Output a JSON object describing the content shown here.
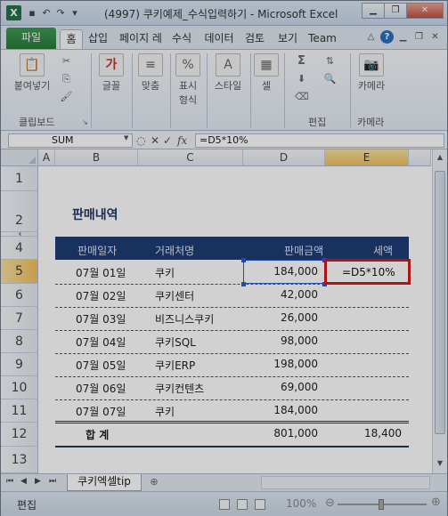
{
  "window": {
    "title": "(4997) 쿠키예제_수식입력하기 - Microsoft Excel",
    "app_icon": "X"
  },
  "ribbon_tabs": [
    "파일",
    "홈",
    "삽입",
    "페이지 레",
    "수식",
    "데이터",
    "검토",
    "보기",
    "Team"
  ],
  "ribbon": {
    "groups": {
      "clipboard": {
        "paste": "붙여넣기",
        "label": "클립보드"
      },
      "font": {
        "label": "글꼴"
      },
      "alignment": {
        "label": "맞춤"
      },
      "number": {
        "label1": "표시",
        "label2": "형식",
        "percent": "%"
      },
      "styles": {
        "label": "스타일"
      },
      "cells": {
        "label": "셀"
      },
      "editing": {
        "label": "편집",
        "sigma": "Σ"
      },
      "camera": {
        "button": "카메라",
        "label": "카메라"
      }
    }
  },
  "formula_bar": {
    "name_box": "SUM",
    "cancel": "✕",
    "enter": "✓",
    "fx": "fx",
    "formula": "=D5*10%"
  },
  "columns": [
    "A",
    "B",
    "C",
    "D",
    "E"
  ],
  "rows": [
    "1",
    "2",
    "3",
    "4",
    "5",
    "6",
    "7",
    "8",
    "9",
    "10",
    "11",
    "12",
    "13"
  ],
  "sheet": {
    "title": "판매내역",
    "headers": [
      "판매일자",
      "거래처명",
      "판매금액",
      "세액"
    ],
    "records": [
      {
        "date": "07월 01일",
        "client": "쿠키",
        "amount": "184,000",
        "tax": "=D5*10%"
      },
      {
        "date": "07월 02일",
        "client": "쿠키센터",
        "amount": "42,000",
        "tax": ""
      },
      {
        "date": "07월 03일",
        "client": "비즈니스쿠키",
        "amount": "26,000",
        "tax": ""
      },
      {
        "date": "07월 04일",
        "client": "쿠키SQL",
        "amount": "98,000",
        "tax": ""
      },
      {
        "date": "07월 05일",
        "client": "쿠키ERP",
        "amount": "198,000",
        "tax": ""
      },
      {
        "date": "07월 06일",
        "client": "쿠키컨텐츠",
        "amount": "69,000",
        "tax": ""
      },
      {
        "date": "07월 07일",
        "client": "쿠키",
        "amount": "184,000",
        "tax": ""
      }
    ],
    "total": {
      "label": "합  계",
      "amount": "801,000",
      "tax": "18,400"
    }
  },
  "sheet_tabs": {
    "active": "쿠키엑셀tip"
  },
  "status_bar": {
    "mode": "편집",
    "zoom": "100%"
  }
}
